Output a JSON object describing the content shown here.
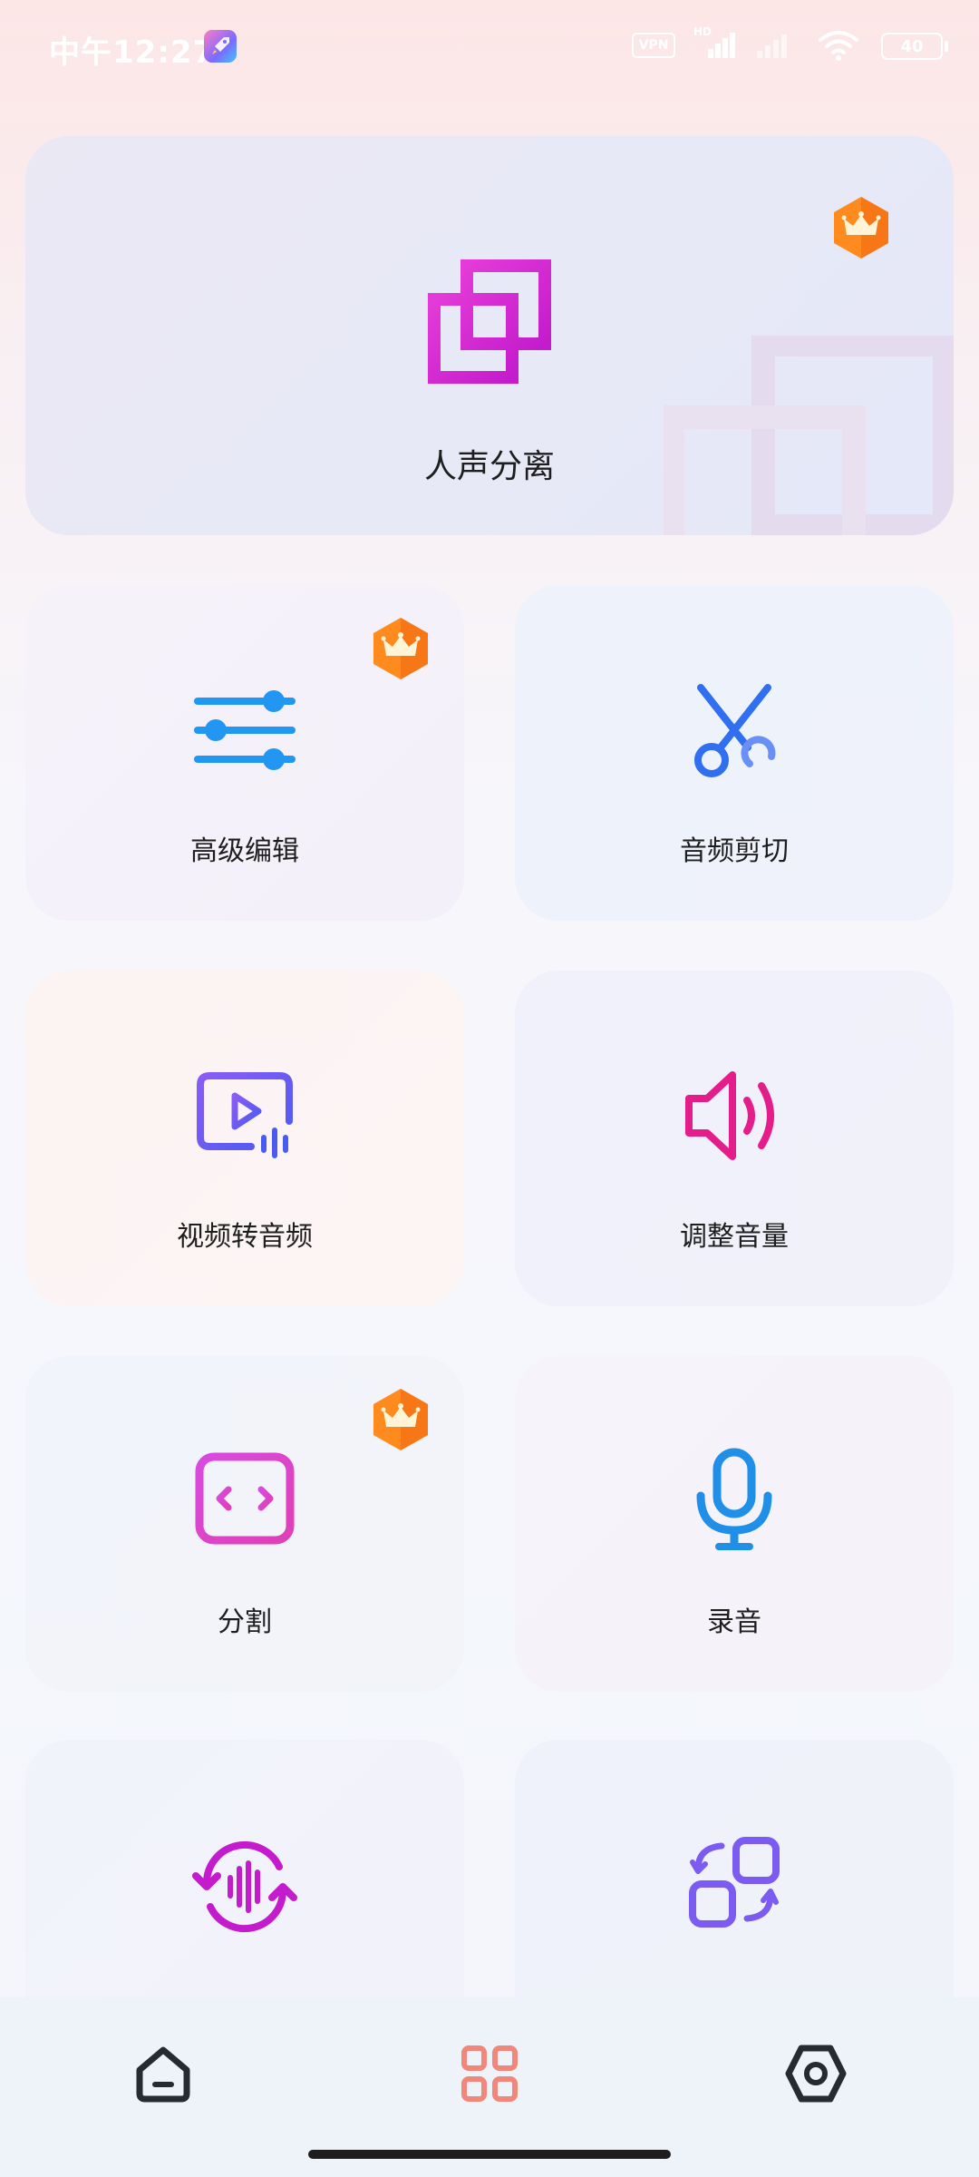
{
  "status_bar": {
    "time": "中午12:27",
    "vpn_label": "VPN",
    "hd_label": "HD",
    "battery": "40"
  },
  "hero": {
    "label": "人声分离",
    "premium": true,
    "icon": "overlap-squares-icon"
  },
  "tiles": [
    {
      "label": "高级编辑",
      "icon": "sliders-icon",
      "premium": true
    },
    {
      "label": "音频剪切",
      "icon": "scissors-icon",
      "premium": false
    },
    {
      "label": "视频转音频",
      "icon": "video-to-audio-icon",
      "premium": false
    },
    {
      "label": "调整音量",
      "icon": "speaker-icon",
      "premium": false
    },
    {
      "label": "分割",
      "icon": "split-icon",
      "premium": true
    },
    {
      "label": "录音",
      "icon": "microphone-icon",
      "premium": false
    },
    {
      "label": "",
      "icon": "audio-cycle-icon",
      "premium": false
    },
    {
      "label": "",
      "icon": "format-convert-icon",
      "premium": false
    }
  ],
  "nav": [
    {
      "name": "home",
      "icon": "home-icon",
      "active": false
    },
    {
      "name": "tools",
      "icon": "grid-icon",
      "active": true
    },
    {
      "name": "settings",
      "icon": "settings-icon",
      "active": false
    }
  ],
  "colors": {
    "accent_magenta": "#d426d0",
    "accent_blue": "#2f8ff5",
    "accent_violet": "#7c5cf0",
    "accent_pink": "#e51d8a",
    "nav_active": "#f0877a",
    "crown_orange": "#ff7a1a"
  }
}
